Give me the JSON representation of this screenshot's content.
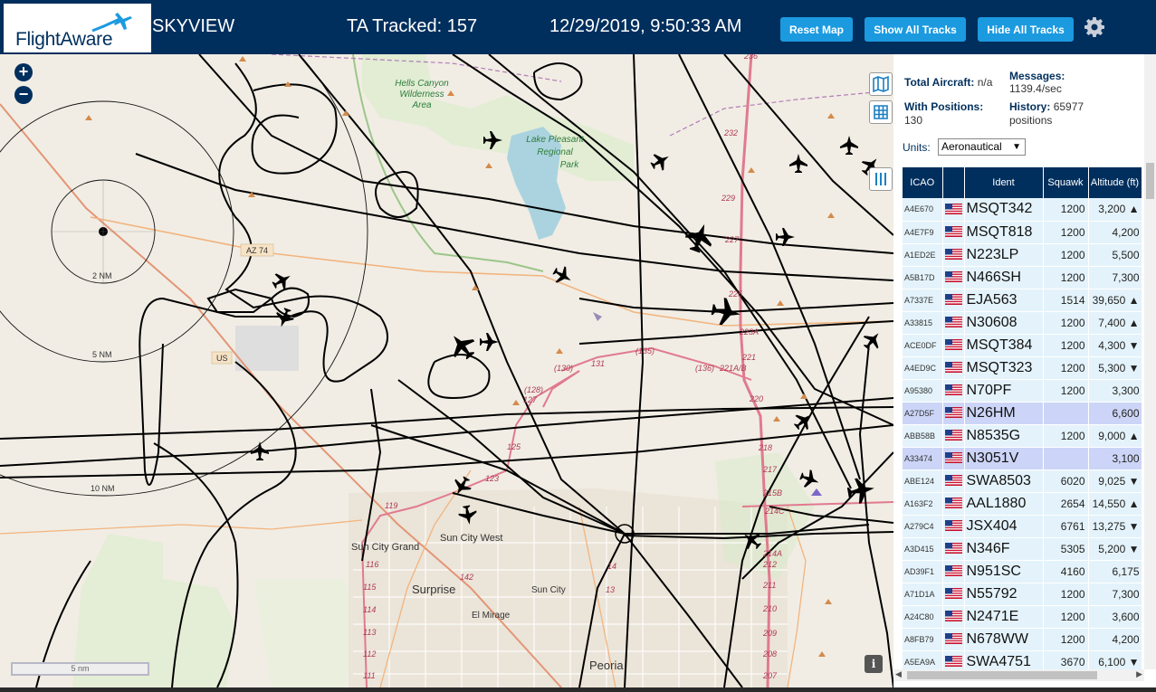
{
  "header": {
    "logo_text": "FlightAware",
    "title": "SKYVIEW",
    "tracked": "TA Tracked: 157",
    "clock": "12/29/2019, 9:50:33 AM",
    "reset_label": "Reset Map",
    "show_label": "Show All Tracks",
    "hide_label": "Hide All Tracks"
  },
  "map": {
    "zoom_in": "+",
    "zoom_out": "−",
    "scale": "5 nm",
    "info": "i",
    "labels": {
      "hells_canyon": "Hells Canyon",
      "wilderness": "Wilderness",
      "area": "Area",
      "lake": "Lake Pleasant",
      "regional": "Regional",
      "park": "Park",
      "az74": "AZ 74",
      "us": "US",
      "ring2": "2 NM",
      "ring5": "5 NM",
      "ring10": "10 NM",
      "sun_city_grand": "Sun City Grand",
      "sun_city_west": "Sun City West",
      "surprise": "Surprise",
      "sun_city": "Sun City",
      "el_mirage": "El Mirage",
      "peoria": "Peoria"
    },
    "road_numbers": [
      "236",
      "232",
      "229",
      "227",
      "225",
      "223A",
      "221",
      "221A/B",
      "220",
      "218",
      "217",
      "215B",
      "214C",
      "214A",
      "212",
      "211",
      "210",
      "209",
      "208",
      "207",
      "(135)",
      "(136)",
      "131",
      "(130)",
      "(128)",
      "127",
      "125",
      "123",
      "119",
      "116",
      "115",
      "114",
      "113",
      "112",
      "111",
      "142",
      "14",
      "13"
    ]
  },
  "sidebar": {
    "total_label": "Total Aircraft:",
    "total_value": "n/a",
    "messages_label": "Messages:",
    "messages_value": "1139.4/sec",
    "positions_label": "With Positions:",
    "positions_value": "130",
    "history_label": "History:",
    "history_value": "65977",
    "history_unit": "positions",
    "units_label": "Units:",
    "units_value": "Aeronautical",
    "columns": [
      "ICAO",
      "",
      "Ident",
      "Squawk",
      "Altitude (ft)"
    ],
    "rows": [
      {
        "icao": "A4E670",
        "ident": "MSQT342",
        "squawk": "1200",
        "alt": "3,200 ▲",
        "sel": false
      },
      {
        "icao": "A4E7F9",
        "ident": "MSQT818",
        "squawk": "1200",
        "alt": "4,200",
        "sel": false
      },
      {
        "icao": "A1ED2E",
        "ident": "N223LP",
        "squawk": "1200",
        "alt": "5,500",
        "sel": false
      },
      {
        "icao": "A5B17D",
        "ident": "N466SH",
        "squawk": "1200",
        "alt": "7,300",
        "sel": false
      },
      {
        "icao": "A7337E",
        "ident": "EJA563",
        "squawk": "1514",
        "alt": "39,650 ▲",
        "sel": false
      },
      {
        "icao": "A33815",
        "ident": "N30608",
        "squawk": "1200",
        "alt": "7,400 ▲",
        "sel": false
      },
      {
        "icao": "ACE0DF",
        "ident": "MSQT384",
        "squawk": "1200",
        "alt": "4,300 ▼",
        "sel": false
      },
      {
        "icao": "A4ED9C",
        "ident": "MSQT323",
        "squawk": "1200",
        "alt": "5,300 ▼",
        "sel": false
      },
      {
        "icao": "A95380",
        "ident": "N70PF",
        "squawk": "1200",
        "alt": "3,300",
        "sel": false
      },
      {
        "icao": "A27D5F",
        "ident": "N26HM",
        "squawk": "",
        "alt": "6,600",
        "sel": true
      },
      {
        "icao": "ABB58B",
        "ident": "N8535G",
        "squawk": "1200",
        "alt": "9,000 ▲",
        "sel": false
      },
      {
        "icao": "A33474",
        "ident": "N3051V",
        "squawk": "",
        "alt": "3,100",
        "sel": true
      },
      {
        "icao": "ABE124",
        "ident": "SWA8503",
        "squawk": "6020",
        "alt": "9,025 ▼",
        "sel": false
      },
      {
        "icao": "A163F2",
        "ident": "AAL1880",
        "squawk": "2654",
        "alt": "14,550 ▲",
        "sel": false
      },
      {
        "icao": "A279C4",
        "ident": "JSX404",
        "squawk": "6761",
        "alt": "13,275 ▼",
        "sel": false
      },
      {
        "icao": "A3D415",
        "ident": "N346F",
        "squawk": "5305",
        "alt": "5,200 ▼",
        "sel": false
      },
      {
        "icao": "AD39F1",
        "ident": "N951SC",
        "squawk": "4160",
        "alt": "6,175",
        "sel": false
      },
      {
        "icao": "A71D1A",
        "ident": "N55792",
        "squawk": "1200",
        "alt": "7,300",
        "sel": false
      },
      {
        "icao": "A24C80",
        "ident": "N2471E",
        "squawk": "1200",
        "alt": "3,600",
        "sel": false
      },
      {
        "icao": "A8FB79",
        "ident": "N678WW",
        "squawk": "1200",
        "alt": "4,200",
        "sel": false
      },
      {
        "icao": "A5EA9A",
        "ident": "SWA4751",
        "squawk": "3670",
        "alt": "6,100 ▼",
        "sel": false
      }
    ]
  },
  "colors": {
    "header_bg": "#002f5d",
    "button_bg": "#1b9ae0",
    "row_bg": "#e4f3fb",
    "row_selected_bg": "#ccd5f7",
    "map_bg": "#f1ede4"
  }
}
